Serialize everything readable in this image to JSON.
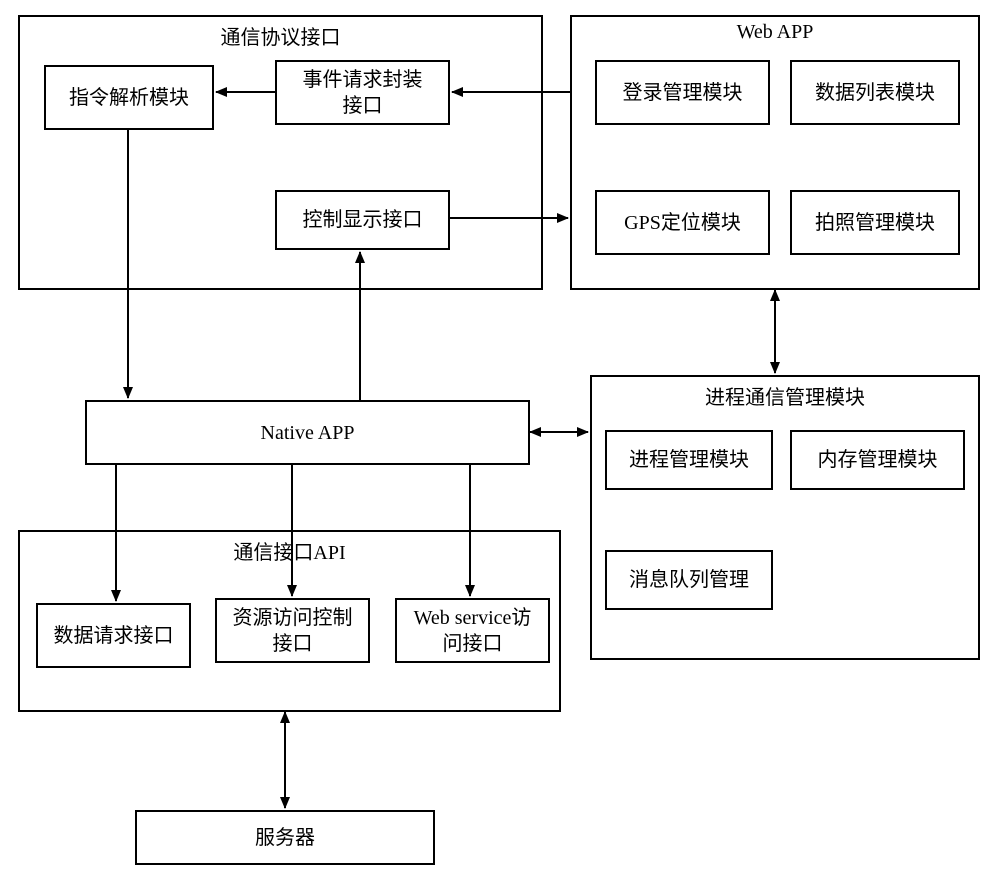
{
  "containers": {
    "protocol": {
      "label": "通信协议接口"
    },
    "webapp": {
      "label": "Web APP"
    },
    "api": {
      "label": "通信接口API"
    },
    "process": {
      "label": "进程通信管理模块"
    }
  },
  "boxes": {
    "parseModule": "指令解析模块",
    "eventRequest": "事件请求封装\n接口",
    "displayControl": "控制显示接口",
    "loginModule": "登录管理模块",
    "dataListModule": "数据列表模块",
    "gpsModule": "GPS定位模块",
    "photoModule": "拍照管理模块",
    "nativeApp": "Native APP",
    "dataRequest": "数据请求接口",
    "resourceAccess": "资源访问控制\n接口",
    "webService": "Web service访\n问接口",
    "processModule": "进程管理模块",
    "memoryModule": "内存管理模块",
    "msgQueue": "消息队列管理",
    "server": "服务器"
  }
}
